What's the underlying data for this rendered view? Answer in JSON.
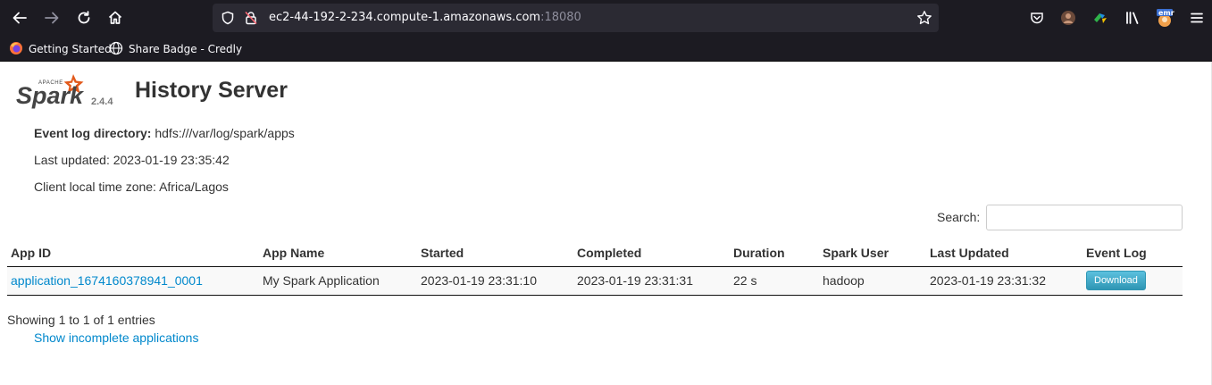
{
  "browser": {
    "url_host": "ec2-44-192-2-234.compute-1.amazonaws.com",
    "url_port": ":18080",
    "bookmarks": [
      {
        "label": "Getting Started",
        "icon": "firefox-icon"
      },
      {
        "label": "Share Badge - Credly",
        "icon": "globe-icon"
      }
    ],
    "extension_badge": "emr"
  },
  "header": {
    "logo_text": "Spark",
    "logo_subtext": "APACHE",
    "version": "2.4.4",
    "title": "History Server"
  },
  "info": {
    "event_log_label": "Event log directory:",
    "event_log_value": "hdfs:///var/log/spark/apps",
    "last_updated": "Last updated: 2023-01-19 23:35:42",
    "time_zone": "Client local time zone: Africa/Lagos"
  },
  "search": {
    "label": "Search:",
    "value": ""
  },
  "table": {
    "columns": [
      "App ID",
      "App Name",
      "Started",
      "Completed",
      "Duration",
      "Spark User",
      "Last Updated",
      "Event Log"
    ],
    "rows": [
      {
        "app_id": "application_1674160378941_0001",
        "app_name": "My Spark Application",
        "started": "2023-01-19 23:31:10",
        "completed": "2023-01-19 23:31:31",
        "duration": "22 s",
        "user": "hadoop",
        "last_updated": "2023-01-19 23:31:32",
        "event_log": "Download"
      }
    ]
  },
  "footer": {
    "showing": "Showing 1 to 1 of 1 entries",
    "incomplete_link": "Show incomplete applications"
  },
  "colors": {
    "link": "#0088cc",
    "spark_orange": "#e25a1c",
    "browser_bg": "#1c1b22"
  }
}
